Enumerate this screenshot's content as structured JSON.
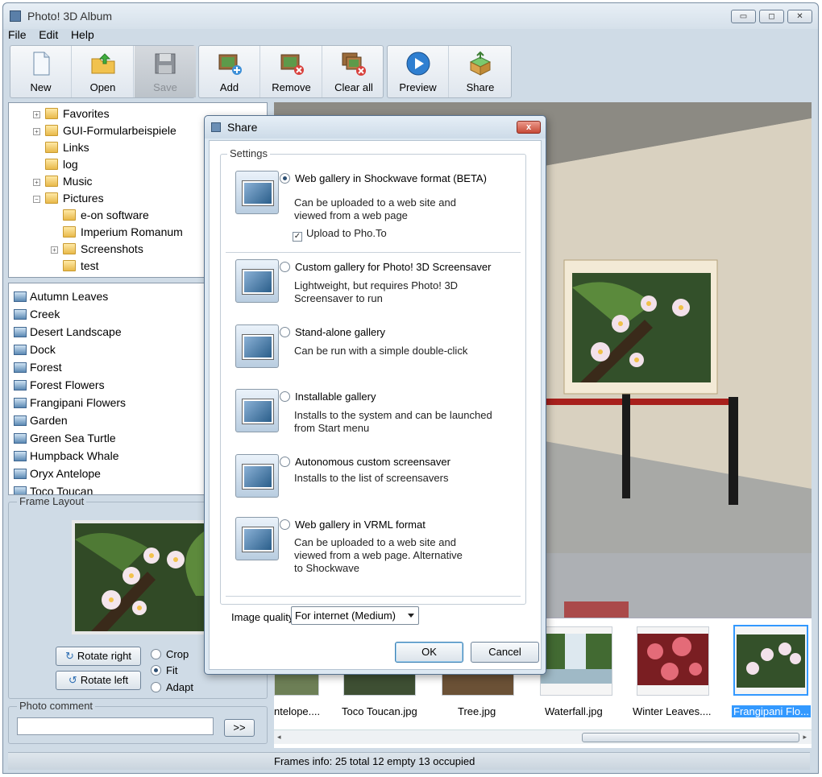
{
  "app": {
    "title": "Photo! 3D Album"
  },
  "window_buttons": {
    "minimize": "▭",
    "maximize": "◻",
    "close": "✕"
  },
  "menu": [
    "File",
    "Edit",
    "Help"
  ],
  "toolbar": {
    "new": "New",
    "open": "Open",
    "save": "Save",
    "add": "Add",
    "remove": "Remove",
    "clear_all": "Clear all",
    "preview": "Preview",
    "share": "Share"
  },
  "tree": {
    "items": [
      "Favorites",
      "GUI-Formularbeispiele",
      "Links",
      "log",
      "Music",
      "Pictures",
      "e-on software",
      "Imperium Romanum",
      "Screenshots",
      "test"
    ]
  },
  "albums": [
    "Autumn Leaves",
    "Creek",
    "Desert Landscape",
    "Dock",
    "Forest",
    "Forest Flowers",
    "Frangipani Flowers",
    "Garden",
    "Green Sea Turtle",
    "Humpback Whale",
    "Oryx Antelope",
    "Toco Toucan"
  ],
  "frame_layout": {
    "label": "Frame Layout",
    "rotate_right": "Rotate right",
    "rotate_left": "Rotate left",
    "crop": "Crop",
    "fit": "Fit",
    "adapt": "Adapt"
  },
  "photo_comment": {
    "label": "Photo comment",
    "go": ">>"
  },
  "thumbnails": [
    "ntelope....",
    "Toco Toucan.jpg",
    "Tree.jpg",
    "Waterfall.jpg",
    "Winter Leaves....",
    "Frangipani Flo..."
  ],
  "status": {
    "text": "Frames info:  25 total  12 empty  13 occupied"
  },
  "dialog": {
    "title": "Share",
    "close": "x",
    "settings_label": "Settings",
    "options": [
      {
        "label": "Web gallery in Shockwave format (BETA)",
        "desc1": "Can be uploaded to a web site and",
        "desc2": "viewed from a web page",
        "check": "Upload to Pho.To"
      },
      {
        "label": "Custom gallery for Photo! 3D Screensaver",
        "desc1": "Lightweight, but requires Photo! 3D",
        "desc2": "Screensaver to run"
      },
      {
        "label": "Stand-alone gallery",
        "desc1": "Can be run with a simple double-click"
      },
      {
        "label": "Installable gallery",
        "desc1": "Installs to the system and can be launched",
        "desc2": "from Start menu"
      },
      {
        "label": "Autonomous custom screensaver",
        "desc1": "Installs to the list of screensavers"
      },
      {
        "label": "Web gallery in VRML format",
        "desc1": "Can be uploaded to a web site and",
        "desc2": "viewed from a web page. Alternative",
        "desc3": "to Shockwave"
      }
    ],
    "image_quality_label": "Image quality",
    "image_quality_value": "For internet (Medium)",
    "ok": "OK",
    "cancel": "Cancel"
  },
  "colors": {
    "accent": "#3a6ea5",
    "selection": "#3399ff"
  }
}
